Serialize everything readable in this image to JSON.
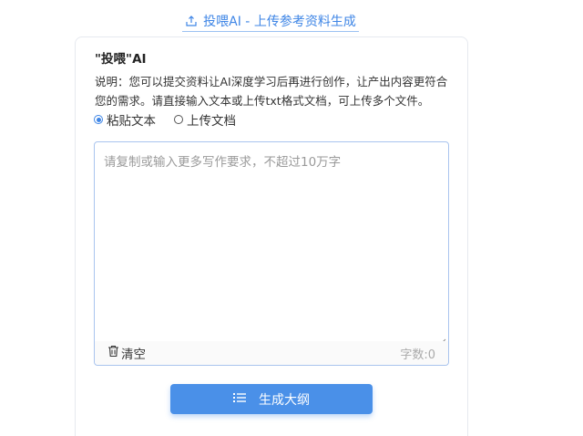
{
  "top_tab": {
    "label": "投喂AI - 上传参考资料生成",
    "icon": "upload-icon"
  },
  "card": {
    "title": "\"投喂\"AI",
    "description": "说明：您可以提交资料让AI深度学习后再进行创作，让产出内容更符合您的需求。请直接输入文本或上传txt格式文档，可上传多个文件。"
  },
  "input_mode": {
    "options": [
      {
        "label": "粘贴文本",
        "checked": true
      },
      {
        "label": "上传文档",
        "checked": false
      }
    ]
  },
  "editor": {
    "value": "",
    "placeholder": "请复制或输入更多写作要求，不超过10万字",
    "clear_label": "清空",
    "word_count_label": "字数:0"
  },
  "generate_button": {
    "label": "生成大纲",
    "icon": "list-icon"
  },
  "colors": {
    "accent": "#4a90e8",
    "link": "#3f86e6",
    "border": "#a9c4ee"
  }
}
